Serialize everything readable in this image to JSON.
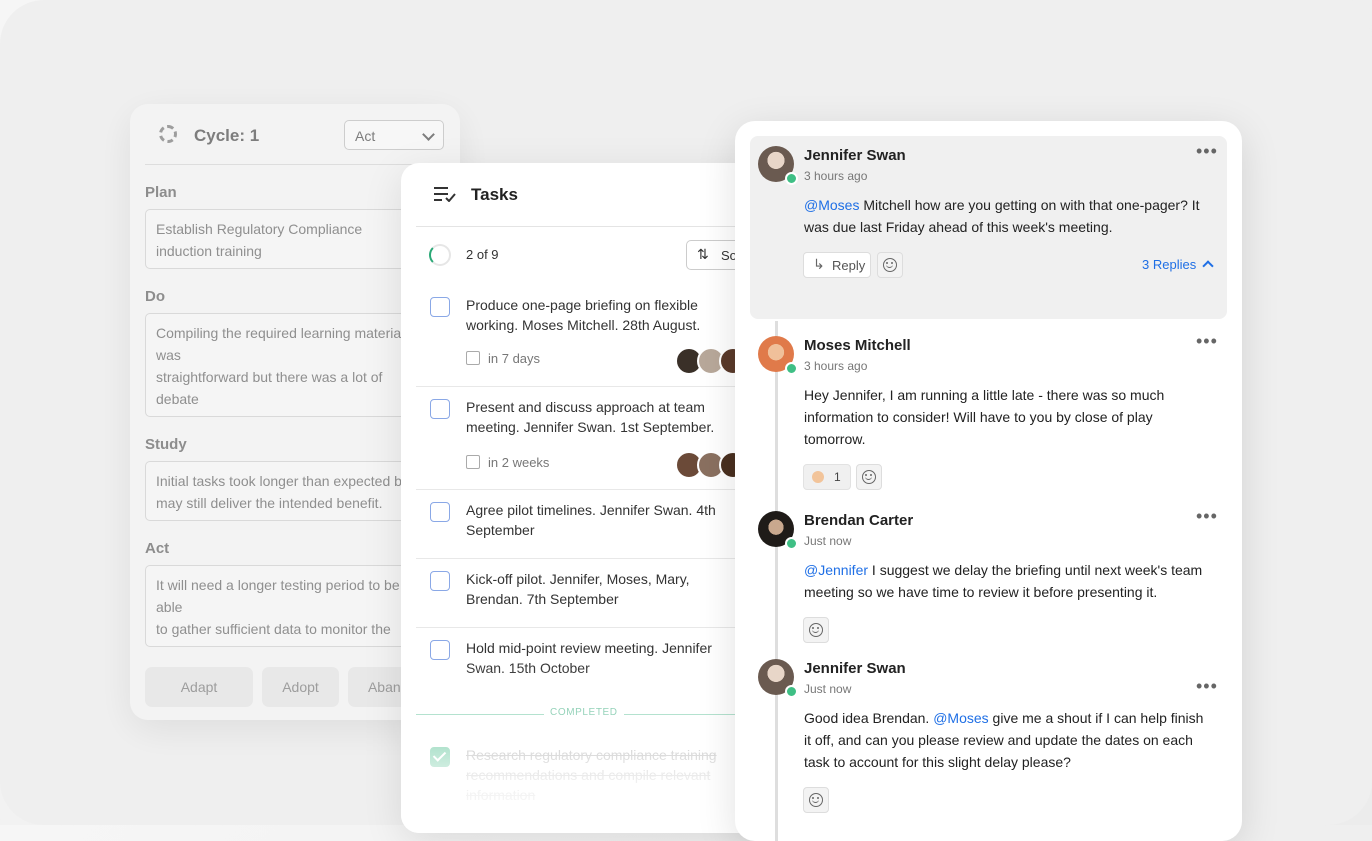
{
  "pdca": {
    "cycle_title": "Cycle: 1",
    "stage_select": "Act",
    "sections": [
      {
        "label": "Plan",
        "text": "Establish Regulatory Compliance\ninduction training"
      },
      {
        "label": "Do",
        "text": "Compiling the required learning material was\nstraightforward but there was a lot of debate\nabout how to tailor it to our organisation and\nmake the material engaging and appropriate"
      },
      {
        "label": "Study",
        "text": "Initial tasks took longer than expected but\nmay still deliver the intended benefit."
      },
      {
        "label": "Act",
        "text": "It will need a longer testing period to be able\nto gather sufficient data to monitor the\nimpact of the change."
      }
    ],
    "buttons": [
      "Adapt",
      "Adopt",
      "Abandon"
    ]
  },
  "tasks": {
    "title": "Tasks",
    "progress": "2 of 9",
    "progress_fraction": 0.22,
    "sort_label": "Sort",
    "items": [
      {
        "text": "Produce one-page briefing on flexible working. Moses Mitchell. 28th August.",
        "due": "in 7 days"
      },
      {
        "text": "Present and discuss approach at team meeting. Jennifer Swan. 1st September.",
        "due": "in 2 weeks"
      },
      {
        "text": "Agree pilot timelines. Jennifer Swan. 4th September"
      },
      {
        "text": "Kick-off pilot. Jennifer, Moses, Mary, Brendan. 7th September"
      },
      {
        "text": "Hold mid-point review meeting. Jennifer Swan. 15th October"
      }
    ],
    "completed_label": "COMPLETED",
    "completed_items": [
      {
        "text": "Research regulatory compliance training recommendations and compile relevant information"
      }
    ]
  },
  "chat": {
    "messages": [
      {
        "author": "Jennifer Swan",
        "time": "3 hours ago",
        "mention": "@Moses",
        "text": " Mitchell how are you getting on with that one-pager? It was due last Friday ahead of this week's meeting.",
        "reply_label": "Reply",
        "replies_label": "3 Replies"
      },
      {
        "author": "Moses Mitchell",
        "time": "3 hours ago",
        "text": "Hey Jennifer, I am running a little late - there was so much information to consider! Will have to you by close of play tomorrow.",
        "reaction_count": "1"
      },
      {
        "author": "Brendan Carter",
        "time": "Just now",
        "mention": "@Jennifer",
        "text": " I suggest we delay the briefing until next week's team meeting so we have time to review it before presenting it."
      },
      {
        "author": "Jennifer Swan",
        "time": "Just now",
        "text_before": "Good idea Brendan. ",
        "mention": "@Moses",
        "text": " give me a shout if I can help finish it off, and can you please review and update the dates on each task to account for this slight delay please?"
      }
    ]
  }
}
